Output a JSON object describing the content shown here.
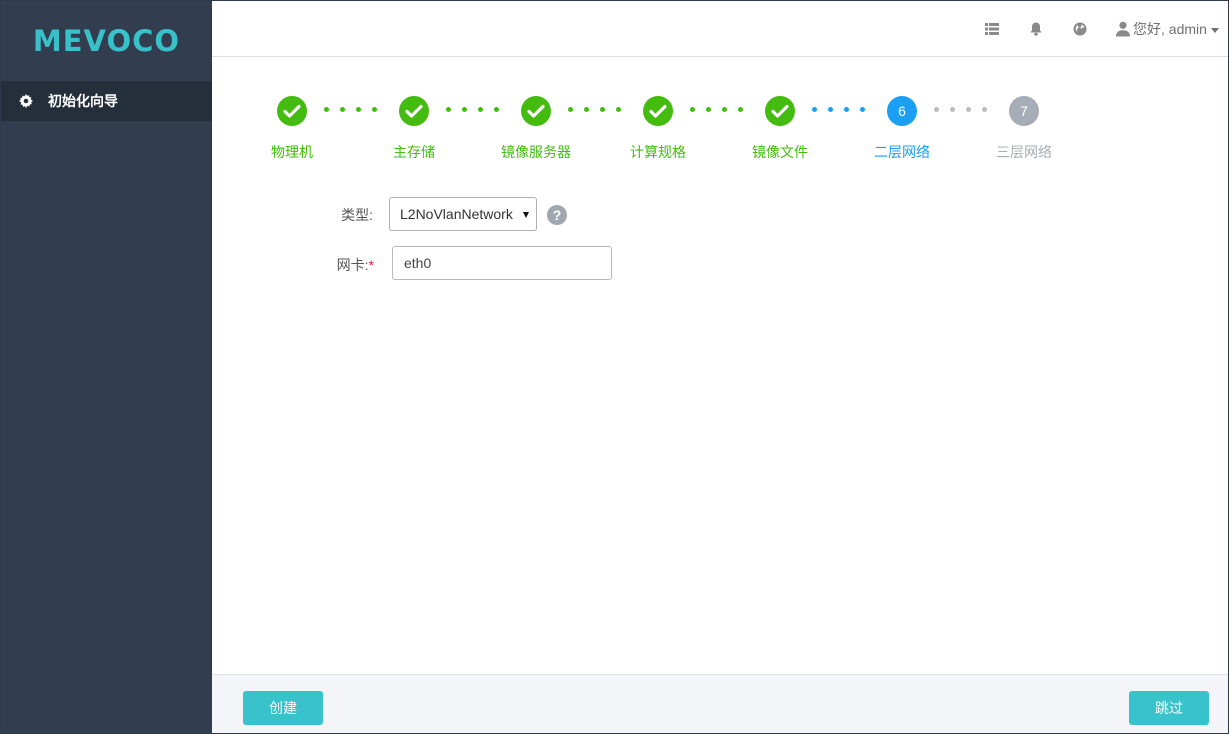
{
  "brand": {
    "logo_text": "MEVOCO",
    "logo_color": "#38c1c8"
  },
  "sidebar": {
    "items": [
      {
        "label": "初始化向导",
        "icon": "gear-icon",
        "active": true
      }
    ]
  },
  "header": {
    "icons": [
      "list-icon",
      "bell-icon",
      "globe-icon"
    ],
    "user": {
      "icon": "user-icon",
      "greeting": "您好, admin"
    }
  },
  "wizard": {
    "steps": [
      {
        "label": "物理机",
        "status": "done"
      },
      {
        "label": "主存储",
        "status": "done"
      },
      {
        "label": "镜像服务器",
        "status": "done"
      },
      {
        "label": "计算规格",
        "status": "done"
      },
      {
        "label": "镜像文件",
        "status": "done"
      },
      {
        "label": "二层网络",
        "status": "active",
        "number": "6"
      },
      {
        "label": "三层网络",
        "status": "pending",
        "number": "7"
      }
    ],
    "colors": {
      "done": "#44bc0f",
      "active": "#1a9ff2",
      "pending": "#a7adb6"
    }
  },
  "form": {
    "type_label": "类型:",
    "type_value": "L2NoVlanNetwork",
    "nic_label": "网卡:",
    "nic_required_mark": "*",
    "nic_value": "eth0"
  },
  "footer": {
    "create_label": "创建",
    "skip_label": "跳过"
  }
}
